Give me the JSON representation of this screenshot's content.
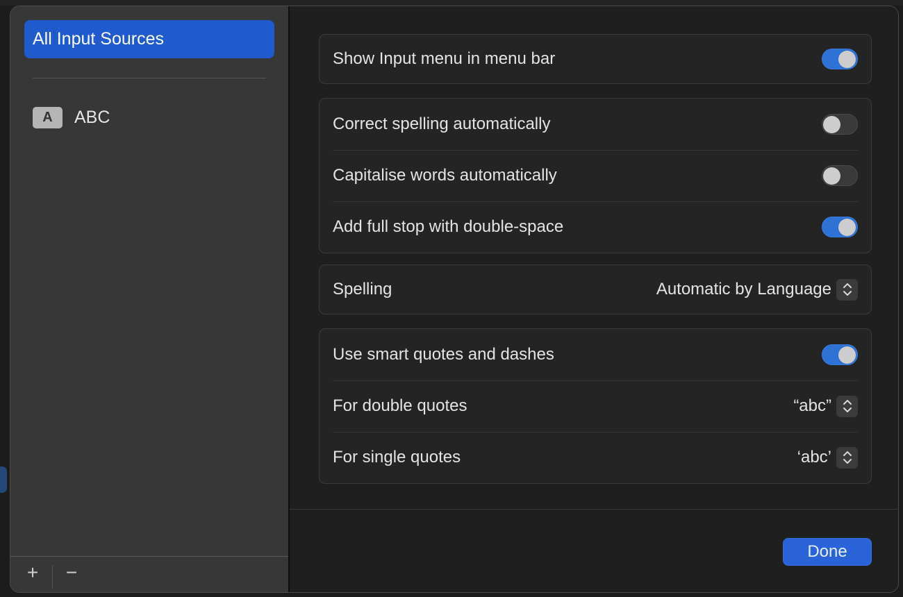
{
  "sidebar": {
    "selected_item": "All Input Sources",
    "items": [
      {
        "badge": "A",
        "label": "ABC"
      }
    ],
    "add_label": "+",
    "remove_label": "−"
  },
  "settings": {
    "show_input_menu": {
      "label": "Show Input menu in menu bar",
      "on": true
    },
    "correct_spelling": {
      "label": "Correct spelling automatically",
      "on": false
    },
    "capitalise_words": {
      "label": "Capitalise words automatically",
      "on": false
    },
    "full_stop": {
      "label": "Add full stop with double-space",
      "on": true
    },
    "spelling": {
      "label": "Spelling",
      "value": "Automatic by Language"
    },
    "smart_quotes": {
      "label": "Use smart quotes and dashes",
      "on": true
    },
    "double_quotes": {
      "label": "For double quotes",
      "value": "“abc”"
    },
    "single_quotes": {
      "label": "For single quotes",
      "value": "‘abc’"
    }
  },
  "footer": {
    "done_label": "Done"
  },
  "colors": {
    "accent": "#2f72d6",
    "selection": "#1f5bcc"
  }
}
